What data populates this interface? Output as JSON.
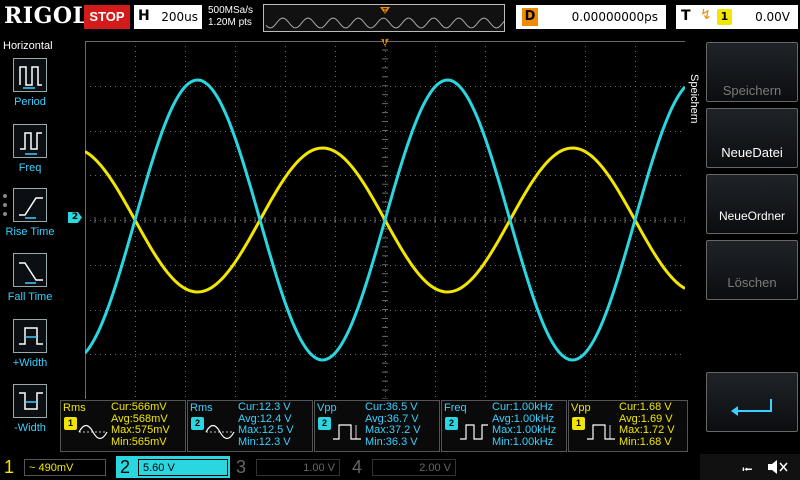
{
  "topbar": {
    "brand": "RIGOL",
    "run_state": "STOP",
    "horizontal_key": "H",
    "timebase": "200us",
    "sample_rate": "500MSa/s",
    "memory_depth": "1.20M pts",
    "delay_key": "D",
    "delay": "0.00000000ps",
    "trigger_key": "T",
    "trigger_edge_icon": "rising-edge-icon",
    "trigger_channel": "1",
    "trigger_level": "0.00V",
    "trigger_marker": "T"
  },
  "left_menu": {
    "title": "Horizontal",
    "items": [
      {
        "label": "Period",
        "icon": "period-icon"
      },
      {
        "label": "Freq",
        "icon": "frequency-icon"
      },
      {
        "label": "Rise Time",
        "icon": "rise-time-icon"
      },
      {
        "label": "Fall Time",
        "icon": "fall-time-icon"
      },
      {
        "label": "+Width",
        "icon": "positive-width-icon"
      },
      {
        "label": "-Width",
        "icon": "negative-width-icon"
      }
    ]
  },
  "right_menu": {
    "title": "Speichern",
    "buttons": [
      {
        "label": "Speichern",
        "enabled": false
      },
      {
        "label": "NeueDatei",
        "enabled": true
      },
      {
        "label": "NeueOrdner",
        "enabled": true
      },
      {
        "label": "Löschen",
        "enabled": false
      },
      {
        "label": "",
        "icon": "return-arrow-icon",
        "enabled": true
      }
    ]
  },
  "plot": {
    "ch2_marker": "2",
    "trigger_level_marker": "T",
    "colors": {
      "ch1": "#f2e600",
      "ch2": "#2ad6e0",
      "grid": "#6b6b6b",
      "trigger": "#f08c00"
    }
  },
  "waveforms": [
    {
      "channel": "1",
      "shape": "sine",
      "frequency_hz": 1000,
      "vpp_v": 1.68,
      "phase": "falling-at-center"
    },
    {
      "channel": "2",
      "shape": "sine",
      "frequency_hz": 1000,
      "vpp_v": 36.5,
      "phase": "rising-at-center"
    }
  ],
  "measurements": [
    {
      "name": "Rms",
      "channel": "1",
      "cur": "Cur:566mV",
      "avg": "Avg:568mV",
      "max": "Max:575mV",
      "min": "Min:565mV",
      "icon": "rms-icon"
    },
    {
      "name": "Rms",
      "channel": "2",
      "cur": "Cur:12.3 V",
      "avg": "Avg:12.4 V",
      "max": "Max:12.5 V",
      "min": "Min:12.3 V",
      "icon": "rms-icon"
    },
    {
      "name": "Vpp",
      "channel": "2",
      "cur": "Cur:36.5 V",
      "avg": "Avg:36.7 V",
      "max": "Max:37.2 V",
      "min": "Min:36.3 V",
      "icon": "vpp-icon"
    },
    {
      "name": "Freq",
      "channel": "2",
      "cur": "Cur:1.00kHz",
      "avg": "Avg:1.00kHz",
      "max": "Max:1.00kHz",
      "min": "Min:1.00kHz",
      "icon": "frequency-icon"
    },
    {
      "name": "Vpp",
      "channel": "1",
      "cur": "Cur:1.68 V",
      "avg": "Avg:1.69 V",
      "max": "Max:1.72 V",
      "min": "Min:1.68 V",
      "icon": "vpp-icon"
    }
  ],
  "channels": [
    {
      "num": "1",
      "scale": "~ 490mV",
      "active": false
    },
    {
      "num": "2",
      "scale": "5.60 V",
      "active": true
    },
    {
      "num": "3",
      "scale": "1.00 V",
      "active": false
    },
    {
      "num": "4",
      "scale": "2.00 V",
      "active": false
    }
  ],
  "status_icons": [
    "usb-icon",
    "speaker-muted-icon"
  ]
}
